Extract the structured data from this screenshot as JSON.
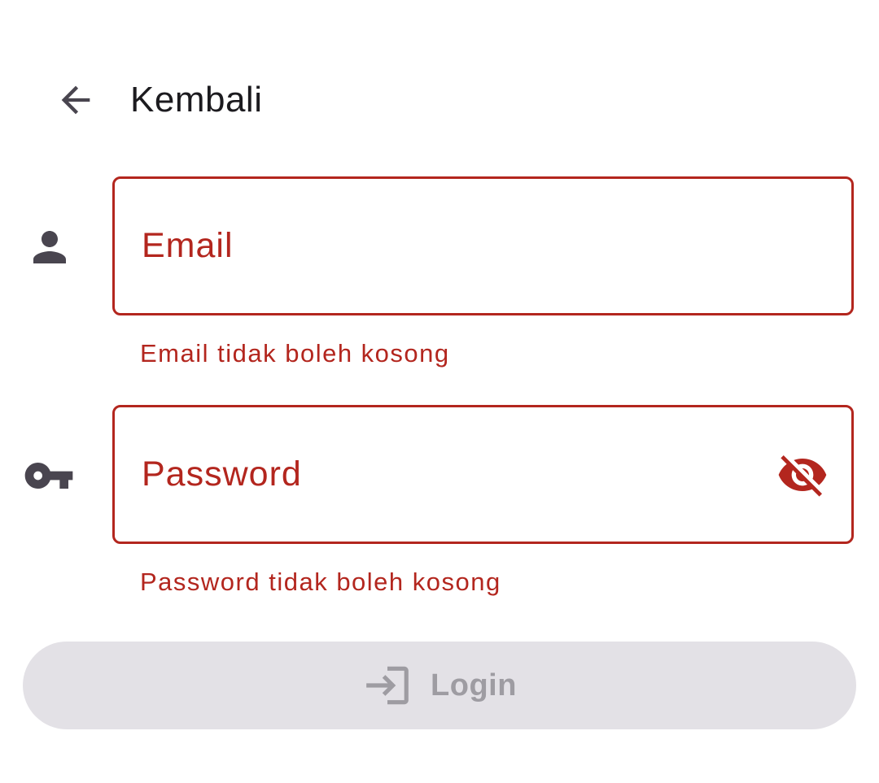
{
  "header": {
    "back_icon": "arrow-left-icon",
    "title": "Kembali"
  },
  "form": {
    "email": {
      "prefix_icon": "person-icon",
      "label": "Email",
      "value": "",
      "error": "Email tidak boleh kosong"
    },
    "password": {
      "prefix_icon": "key-icon",
      "label": "Password",
      "value": "",
      "visibility_icon": "eye-off-icon",
      "error": "Password tidak boleh kosong"
    },
    "login": {
      "icon": "login-icon",
      "label": "Login",
      "enabled": false
    }
  },
  "colors": {
    "error": "#b3261e",
    "icon": "#49454f",
    "text": "#1c1b1f",
    "disabled_bg": "#e3e1e6",
    "disabled_fg": "#9e9ca2"
  }
}
